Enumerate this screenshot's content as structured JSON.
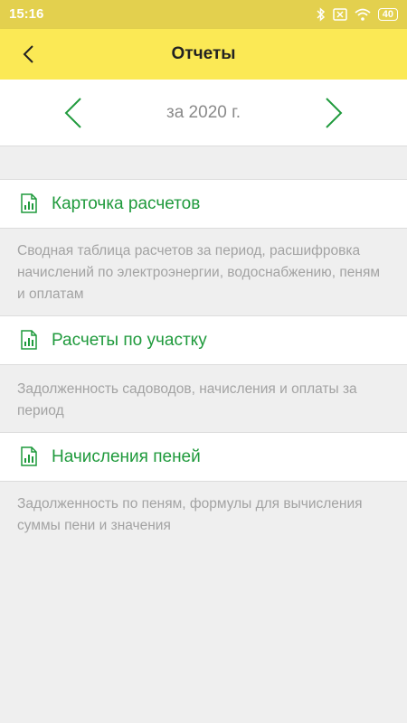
{
  "status_bar": {
    "time": "15:16",
    "battery": "40"
  },
  "app_bar": {
    "title": "Отчеты"
  },
  "period": {
    "label": "за 2020 г."
  },
  "reports": [
    {
      "title": "Карточка расчетов",
      "description": "Сводная таблица расчетов за период, расшифровка начислений по электроэнергии, водоснабжению, пеням и оплатам"
    },
    {
      "title": "Расчеты по участку",
      "description": "Задолженность садоводов, начисления и оплаты за период"
    },
    {
      "title": "Начисления пеней",
      "description": "Задолженность по пеням, формулы для вычисления суммы пени и значения"
    }
  ],
  "colors": {
    "accent": "#fbe955",
    "link": "#1f9a3c",
    "muted_text": "#a3a3a3"
  },
  "icons": {
    "back": "chevron-left-icon",
    "prev": "chevron-left-icon",
    "next": "chevron-right-icon",
    "report": "report-chart-icon"
  }
}
